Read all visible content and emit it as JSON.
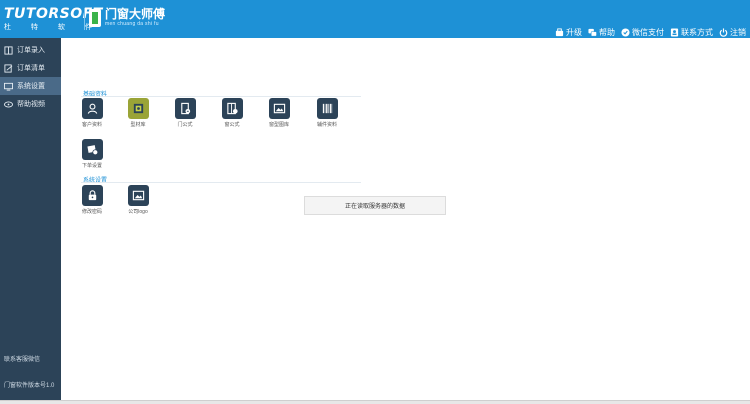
{
  "header": {
    "brand": "TUTORSOFT",
    "brand_cn": "杜 特 软 件",
    "product": "门窗大师傅",
    "product_pinyin": "men chuang da shi fu",
    "actions": [
      {
        "label": "升级",
        "icon": "upgrade-icon"
      },
      {
        "label": "帮助",
        "icon": "help-icon"
      },
      {
        "label": "微信支付",
        "icon": "wechat-pay-icon"
      },
      {
        "label": "联系方式",
        "icon": "contact-icon"
      },
      {
        "label": "注销",
        "icon": "power-icon"
      }
    ]
  },
  "sidebar": {
    "items": [
      {
        "label": "订单录入",
        "icon": "order-entry-icon"
      },
      {
        "label": "订单清单",
        "icon": "order-list-icon"
      },
      {
        "label": "系统设置",
        "icon": "system-settings-icon"
      },
      {
        "label": "帮助视频",
        "icon": "help-video-icon"
      }
    ],
    "active_index": 2,
    "bottom_top": "联系客服微信",
    "bottom_bottom": "门窗软件版本号1.0"
  },
  "main": {
    "section_basic": "基础资料",
    "tiles_basic": [
      {
        "label": "客户资料",
        "icon": "customer-icon"
      },
      {
        "label": "型材库",
        "icon": "profile-library-icon"
      },
      {
        "label": "门公式",
        "icon": "door-formula-icon"
      },
      {
        "label": "窗公式",
        "icon": "window-formula-icon"
      },
      {
        "label": "窗型图库",
        "icon": "window-gallery-icon"
      },
      {
        "label": "辅件资料",
        "icon": "accessory-icon"
      },
      {
        "label": "下单设置",
        "icon": "order-settings-icon"
      }
    ],
    "section_other": "系统设置",
    "tiles_other": [
      {
        "label": "修改密码",
        "icon": "lock-icon"
      },
      {
        "label": "公司logo",
        "icon": "company-logo-icon"
      }
    ],
    "toast": "正在读取服务器的数据"
  },
  "colors": {
    "header": "#1e91d6",
    "sidebar": "#2c4358",
    "sidebar_active": "#4a6a88",
    "tile": "#2c4358",
    "tile_yellow": "#9aa437"
  }
}
